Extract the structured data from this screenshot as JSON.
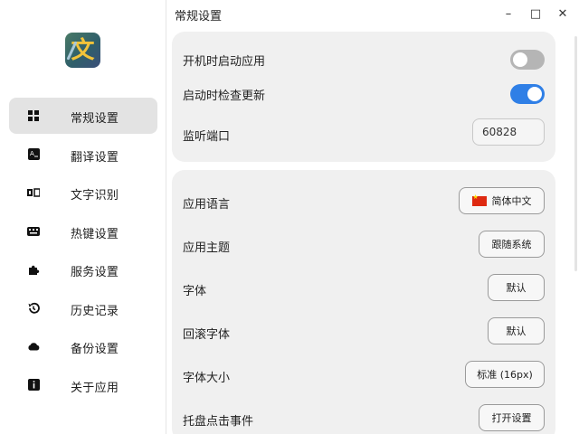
{
  "window": {
    "title": "常规设置",
    "minimize": "–",
    "maximize": "□",
    "close": "✕"
  },
  "logo": {
    "glyph": "文",
    "icon": "app-logo-icon"
  },
  "sidebar": {
    "items": [
      {
        "label": "常规设置",
        "icon": "grid-icon",
        "active": true
      },
      {
        "label": "翻译设置",
        "icon": "translate-icon",
        "active": false
      },
      {
        "label": "文字识别",
        "icon": "ocr-icon",
        "active": false
      },
      {
        "label": "热键设置",
        "icon": "keyboard-icon",
        "active": false
      },
      {
        "label": "服务设置",
        "icon": "puzzle-icon",
        "active": false
      },
      {
        "label": "历史记录",
        "icon": "history-icon",
        "active": false
      },
      {
        "label": "备份设置",
        "icon": "cloud-icon",
        "active": false
      },
      {
        "label": "关于应用",
        "icon": "info-icon",
        "active": false
      }
    ]
  },
  "general": {
    "autostart_label": "开机时启动应用",
    "autostart_on": false,
    "check_update_label": "启动时检查更新",
    "check_update_on": true,
    "port_label": "监听端口",
    "port_value": "60828"
  },
  "appearance": {
    "language_label": "应用语言",
    "language_value": "简体中文",
    "theme_label": "应用主题",
    "theme_value": "跟随系统",
    "font_label": "字体",
    "font_value": "默认",
    "fallback_font_label": "回滚字体",
    "fallback_font_value": "默认",
    "font_size_label": "字体大小",
    "font_size_value": "标准 (16px)",
    "tray_click_label": "托盘点击事件",
    "tray_click_value": "打开设置"
  },
  "colors": {
    "accent": "#2f7fe6",
    "toggle_off": "#b5b5b5",
    "card_bg": "#f0f0f0",
    "active_nav_bg": "#e3e3e3"
  }
}
